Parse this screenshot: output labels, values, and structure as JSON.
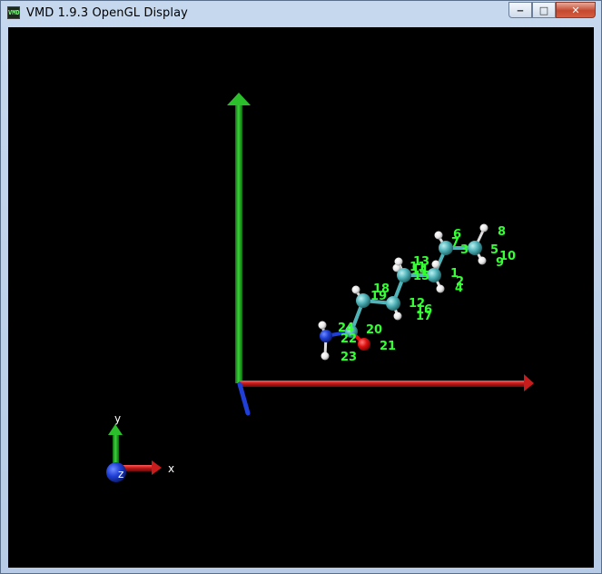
{
  "window": {
    "title": "VMD 1.9.3 OpenGL Display",
    "icon_text": "VMD"
  },
  "controls": {
    "minimize": "‒",
    "maximize": "□",
    "close": "✕"
  },
  "axes": {
    "x": "x",
    "y": "y",
    "z": "z"
  },
  "atom_labels": [
    "1",
    "2",
    "3",
    "4",
    "5",
    "6",
    "7",
    "8",
    "9",
    "10",
    "11",
    "12",
    "13",
    "14",
    "15",
    "16",
    "17",
    "18",
    "19",
    "20",
    "21",
    "22",
    "23",
    "24"
  ],
  "colors": {
    "carbon": "#4fb3b8",
    "hydrogen": "#f2f2f2",
    "nitrogen": "#1f3fd6",
    "oxygen": "#e01010",
    "label": "#33ff33",
    "axis_x": "#c81c1c",
    "axis_y": "#1aa01a",
    "axis_z": "#1f3fd6"
  }
}
